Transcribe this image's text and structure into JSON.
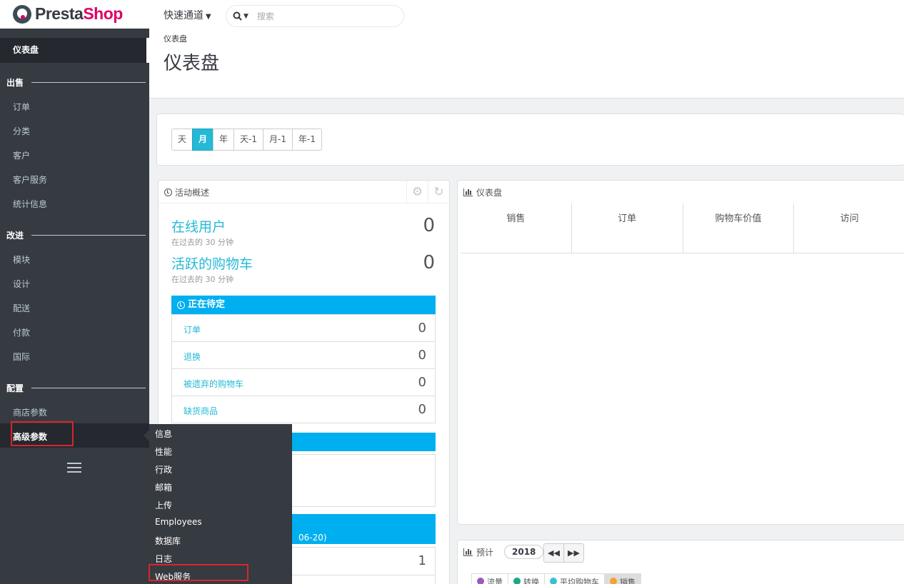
{
  "header": {
    "logo": {
      "part1": "Presta",
      "part2": "Shop"
    },
    "quick_access": "快速通道",
    "search_placeholder": "搜索"
  },
  "sidebar": {
    "dashboard": "仪表盘",
    "sections": [
      {
        "title": "出售",
        "items": [
          "订单",
          "分类",
          "客户",
          "客户服务",
          "统计信息"
        ]
      },
      {
        "title": "改进",
        "items": [
          "模块",
          "设计",
          "配送",
          "付款",
          "国际"
        ]
      },
      {
        "title": "配置",
        "items": [
          "商店参数",
          "高级参数"
        ]
      }
    ]
  },
  "flyout": {
    "items": [
      "信息",
      "性能",
      "行政",
      "邮箱",
      "上传",
      "Employees",
      "数据库",
      "日志",
      "Web服务"
    ]
  },
  "page": {
    "breadcrumb": "仪表盘",
    "title": "仪表盘"
  },
  "period": {
    "buttons": [
      "天",
      "月",
      "年",
      "天-1",
      "月-1",
      "年-1"
    ],
    "active": "月"
  },
  "activity": {
    "title": "活动概述",
    "online_users": {
      "label": "在线用户",
      "note": "在过去的 30 分钟",
      "value": "0"
    },
    "active_carts": {
      "label": "活跃的购物车",
      "note": "在过去的 30 分钟",
      "value": "0"
    },
    "pending": {
      "title": "正在待定",
      "rows": [
        {
          "label": "订单",
          "value": "0"
        },
        {
          "label": "退换",
          "value": "0"
        },
        {
          "label": "被遗弃的购物车",
          "value": "0"
        },
        {
          "label": "缺货商品",
          "value": "0"
        }
      ]
    },
    "third_bar_fragment": "06-20)",
    "bottom_value": "1"
  },
  "dashboard": {
    "title": "仪表盘",
    "columns": [
      "销售",
      "订单",
      "购物车价值",
      "访问"
    ]
  },
  "forecast": {
    "title": "预计",
    "year": "2018",
    "legend": [
      {
        "label": "流量",
        "color": "#9c5ab8"
      },
      {
        "label": "转换",
        "color": "#1aa989"
      },
      {
        "label": "平均购物车",
        "color": "#34c3d4"
      },
      {
        "label": "销售",
        "color": "#f5a232"
      }
    ]
  }
}
